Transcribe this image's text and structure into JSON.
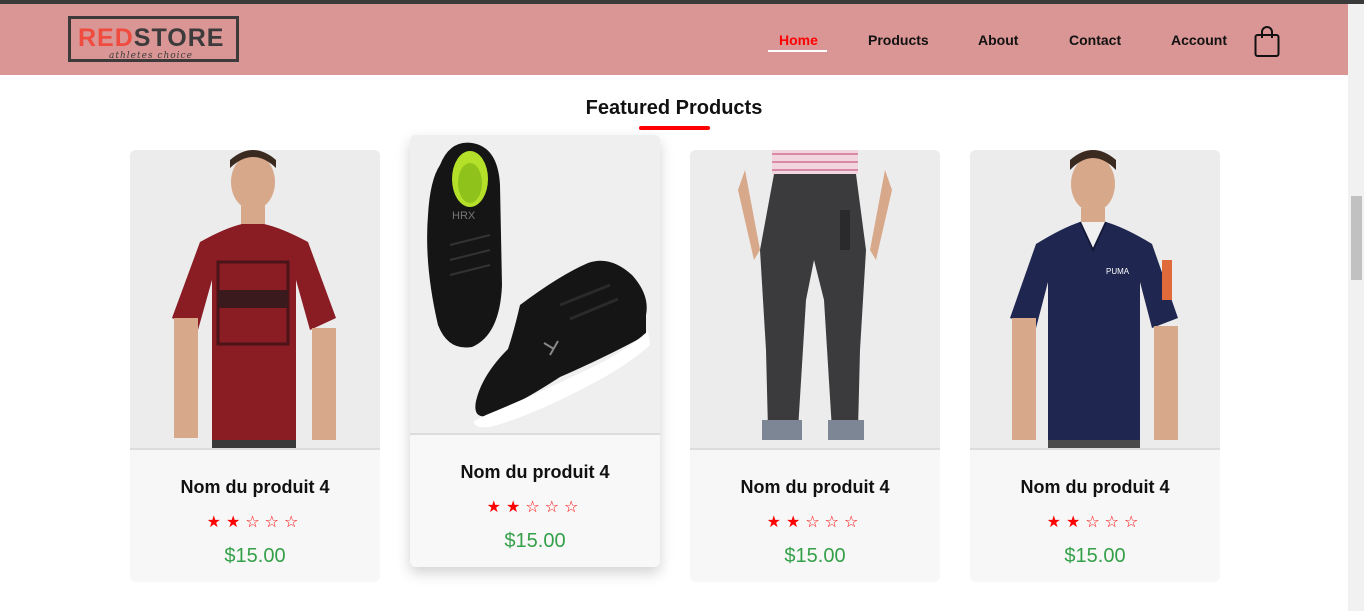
{
  "brand": {
    "logo_red": "RED",
    "logo_dark": "STORE",
    "tagline": "athletes choice"
  },
  "nav": {
    "items": [
      {
        "label": "Home",
        "active": true
      },
      {
        "label": "Products",
        "active": false
      },
      {
        "label": "About",
        "active": false
      },
      {
        "label": "Contact",
        "active": false
      },
      {
        "label": "Account",
        "active": false
      }
    ],
    "cart_icon": "shopping-bag-icon"
  },
  "colors": {
    "header_bg": "#da9695",
    "accent": "#ff0000",
    "price": "#35a04a",
    "logo_red": "#ef4b3f",
    "logo_dark": "#3d3a3c"
  },
  "featured": {
    "title": "Featured Products",
    "products": [
      {
        "name": "Nom du produit 4",
        "rating": 2,
        "max_rating": 5,
        "price": "$15.00",
        "image": "red-tshirt-model"
      },
      {
        "name": "Nom du produit 4",
        "rating": 2,
        "max_rating": 5,
        "price": "$15.00",
        "image": "black-sneakers"
      },
      {
        "name": "Nom du produit 4",
        "rating": 2,
        "max_rating": 5,
        "price": "$15.00",
        "image": "grey-joggers-model"
      },
      {
        "name": "Nom du produit 4",
        "rating": 2,
        "max_rating": 5,
        "price": "$15.00",
        "image": "navy-polo-model"
      }
    ]
  }
}
